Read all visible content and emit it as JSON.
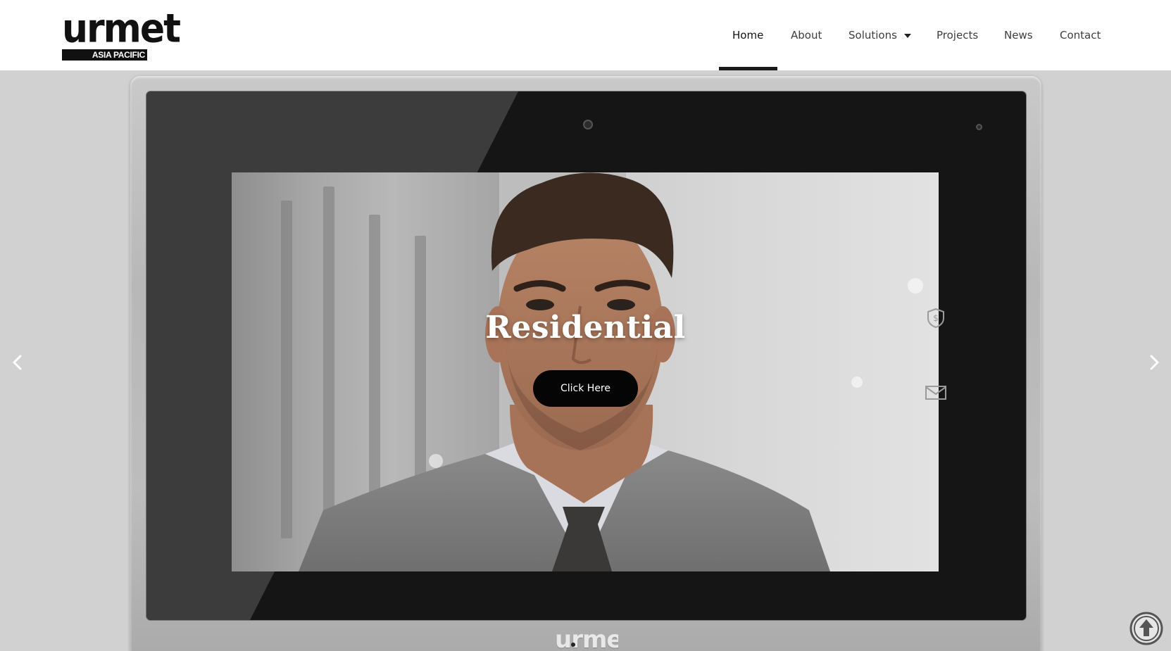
{
  "brand": {
    "logo_word": "urmet",
    "logo_band": "ASIA PACIFIC"
  },
  "nav": {
    "items": [
      {
        "label": "Home",
        "active": true
      },
      {
        "label": "About"
      },
      {
        "label": "Solutions",
        "has_dropdown": true
      },
      {
        "label": "Projects"
      },
      {
        "label": "News"
      },
      {
        "label": "Contact"
      }
    ]
  },
  "hero": {
    "slide_title": "Residential",
    "cta_label": "Click Here",
    "device_logo": "urmet",
    "prev_icon": "chevron-left-icon",
    "next_icon": "chevron-right-icon",
    "side_icons": [
      "shield-dollar-icon",
      "envelope-icon"
    ]
  },
  "utility": {
    "back_to_top_icon": "arrow-up-circle-icon"
  },
  "colors": {
    "accent": "#111111",
    "hero_bg": "#d1d1d1",
    "button_bg": "#050505"
  }
}
